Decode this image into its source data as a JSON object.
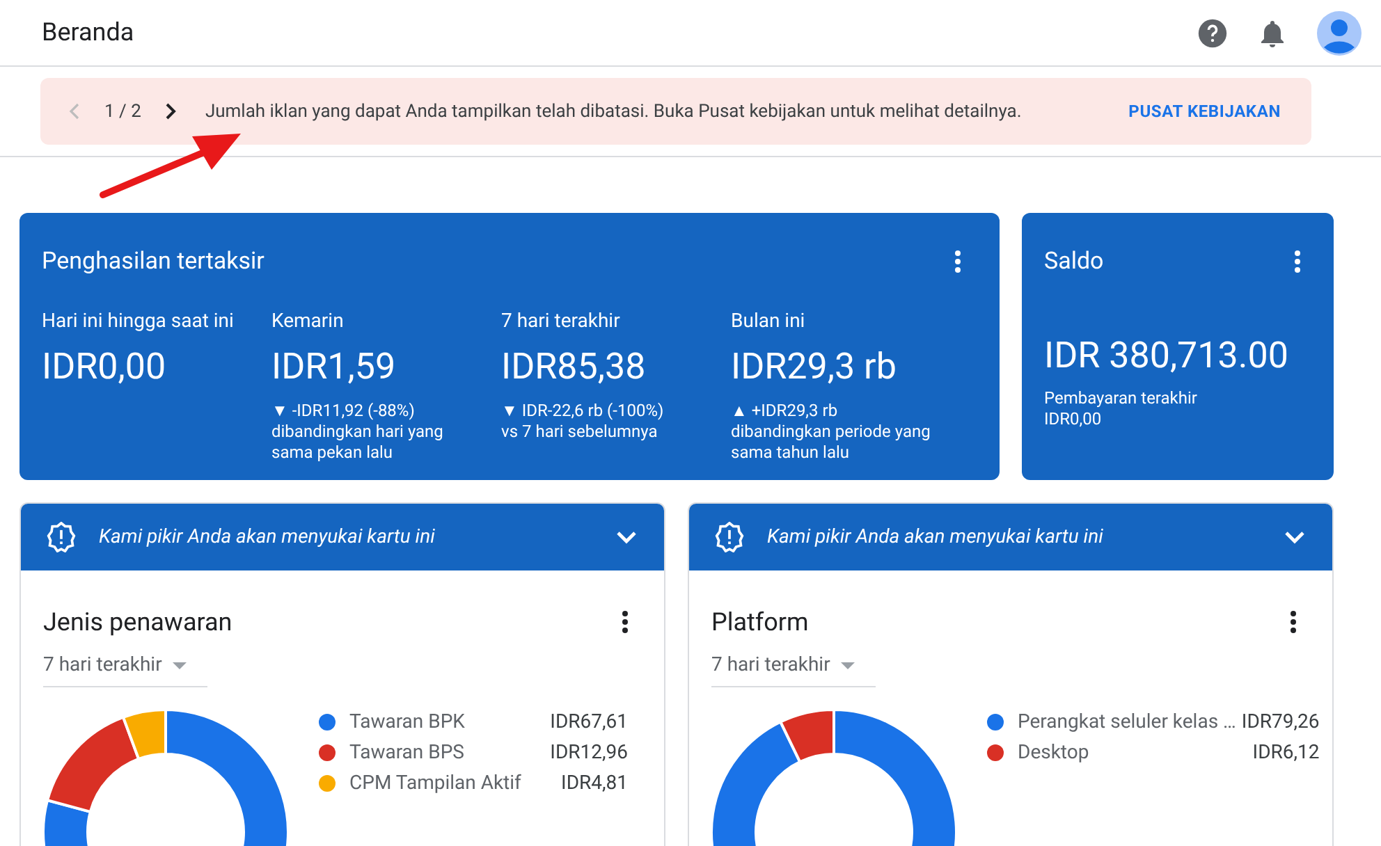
{
  "header": {
    "title": "Beranda"
  },
  "banner": {
    "pager": "1 / 2",
    "prev_disabled": true,
    "next_disabled": false,
    "message": "Jumlah iklan yang dapat Anda tampilkan telah dibatasi. Buka Pusat kebijakan untuk melihat detailnya.",
    "action": "PUSAT KEBIJAKAN"
  },
  "earnings": {
    "title": "Penghasilan tertaksir",
    "metrics": [
      {
        "label": "Hari ini hingga saat ini",
        "value": "IDR0,00"
      },
      {
        "label": "Kemarin",
        "value": "IDR1,59",
        "change": "▼ -IDR11,92 (-88%)",
        "note": "dibandingkan hari yang sama pekan lalu"
      },
      {
        "label": "7 hari terakhir",
        "value": "IDR85,38",
        "change": "▼ IDR-22,6 rb (-100%)",
        "note": "vs 7 hari sebelumnya"
      },
      {
        "label": "Bulan ini",
        "value": "IDR29,3 rb",
        "change": "▲ +IDR29,3 rb",
        "note": "dibandingkan periode yang sama tahun lalu"
      }
    ]
  },
  "balance": {
    "title": "Saldo",
    "value": "IDR 380,713.00",
    "last_payment_label": "Pembayaran terakhir",
    "last_payment_value": "IDR0,00"
  },
  "cards": [
    {
      "banner": "Kami pikir Anda akan menyukai kartu ini",
      "title": "Jenis penawaran",
      "range": "7 hari terakhir",
      "legend": [
        {
          "label": "Tawaran BPK",
          "value": "IDR67,61",
          "color": "#1a73e8"
        },
        {
          "label": "Tawaran BPS",
          "value": "IDR12,96",
          "color": "#d93025"
        },
        {
          "label": "CPM Tampilan Aktif",
          "value": "IDR4,81",
          "color": "#f9ab00"
        }
      ],
      "chart_data": {
        "type": "donut",
        "values": [
          79.19,
          15.18,
          5.63
        ]
      }
    },
    {
      "banner": "Kami pikir Anda akan menyukai kartu ini",
      "title": "Platform",
      "range": "7 hari terakhir",
      "legend": [
        {
          "label": "Perangkat seluler kelas …",
          "value": "IDR79,26",
          "color": "#1a73e8"
        },
        {
          "label": "Desktop",
          "value": "IDR6,12",
          "color": "#d93025"
        }
      ],
      "chart_data": {
        "type": "donut",
        "values": [
          92.83,
          7.17
        ]
      }
    }
  ]
}
